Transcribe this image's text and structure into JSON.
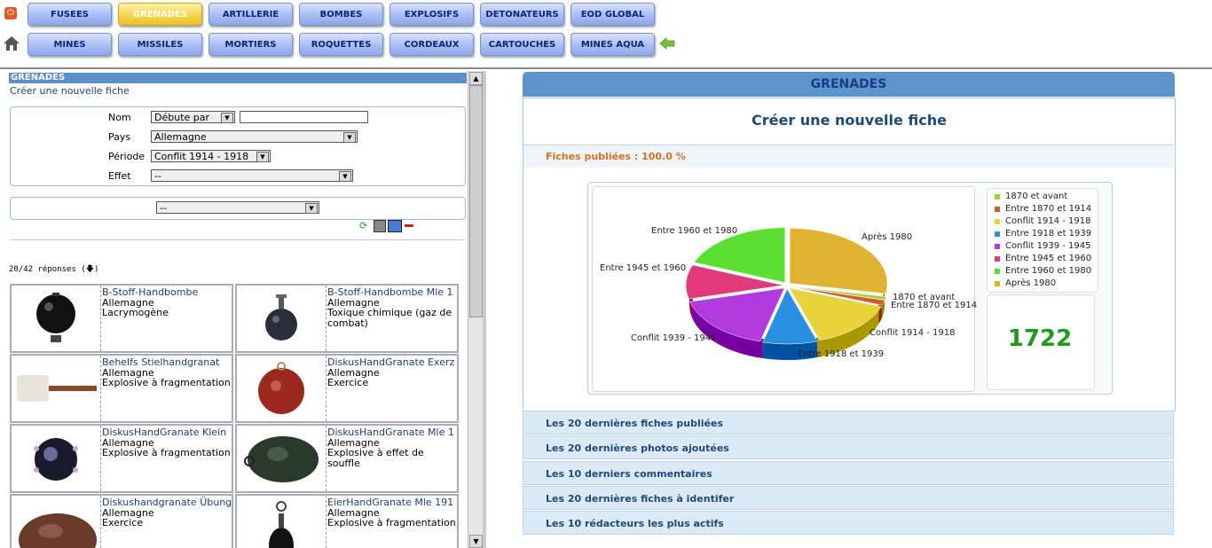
{
  "nav": {
    "row1": [
      "FUSEES",
      "GRENADES",
      "ARTILLERIE",
      "BOMBES",
      "EXPLOSIFS",
      "DETONATEURS",
      "EOD GLOBAL"
    ],
    "row2": [
      "MINES",
      "MISSILES",
      "MORTIERS",
      "ROQUETTES",
      "CORDEAUX",
      "CARTOUCHES",
      "MINES AQUA"
    ],
    "active": "GRENADES"
  },
  "left": {
    "header": "GRENADES",
    "create_link": "Créer une nouvelle fiche",
    "form": {
      "nom_label": "Nom",
      "nom_mode": "Débute par",
      "nom_value": "",
      "pays_label": "Pays",
      "pays_value": "Allemagne",
      "periode_label": "Période",
      "periode_value": "Conflit 1914 - 1918",
      "effet_label": "Effet",
      "effet_value": "--",
      "extra_value": "--"
    },
    "results_count": "20/42 réponses (🡇)",
    "cards": [
      {
        "title": "B-Stoff-Handbombe",
        "country": "Allemagne",
        "effect": "Lacrymogène"
      },
      {
        "title": "B-Stoff-Handbombe Mle 1",
        "country": "Allemagne",
        "effect": "Toxique chimique (gaz de combat)"
      },
      {
        "title": "Behelfs Stielhandgranat",
        "country": "Allemagne",
        "effect": "Explosive à fragmentation"
      },
      {
        "title": "DiskusHandGranate Exerz",
        "country": "Allemagne",
        "effect": "Exercice"
      },
      {
        "title": "DiskusHandGranate Klein",
        "country": "Allemagne",
        "effect": "Explosive à fragmentation"
      },
      {
        "title": "DiskusHandGranate Mle 1",
        "country": "Allemagne",
        "effect": "Explosive à effet de souffle"
      },
      {
        "title": "Diskushandgranate Übung",
        "country": "Allemagne",
        "effect": "Exercice"
      },
      {
        "title": "EierHandGranate Mle 191",
        "country": "Allemagne",
        "effect": "Explosive à fragmentation"
      }
    ]
  },
  "right": {
    "header": "GRENADES",
    "create_title": "Créer une nouvelle fiche",
    "published": "Fiches publiées : 100.0 %",
    "total": "1722",
    "accordion": [
      "Les 20 dernières fiches publiées",
      "Les 20 dernières photos ajoutées",
      "Les 10 derniers commentaires",
      "Les 20 dernières fiches à identifer",
      "Les 10 rédacteurs les plus actifs"
    ]
  },
  "chart_data": {
    "type": "pie",
    "categories": [
      "1870 et avant",
      "Entre 1870 et 1914",
      "Conflit 1914 - 1918",
      "Entre 1918 et 1939",
      "Conflit 1939 - 1945",
      "Entre 1945 et 1960",
      "Entre 1960 et 1980",
      "Après 1980"
    ],
    "values": [
      1.0,
      1.5,
      14.5,
      9.0,
      17.0,
      10.0,
      19.0,
      28.0
    ],
    "colors": [
      "#a5d23b",
      "#d45a2a",
      "#e6d43a",
      "#2b8fe0",
      "#b23be0",
      "#e03a7a",
      "#5ae032",
      "#e0b232"
    ],
    "legend": "right",
    "title": ""
  }
}
